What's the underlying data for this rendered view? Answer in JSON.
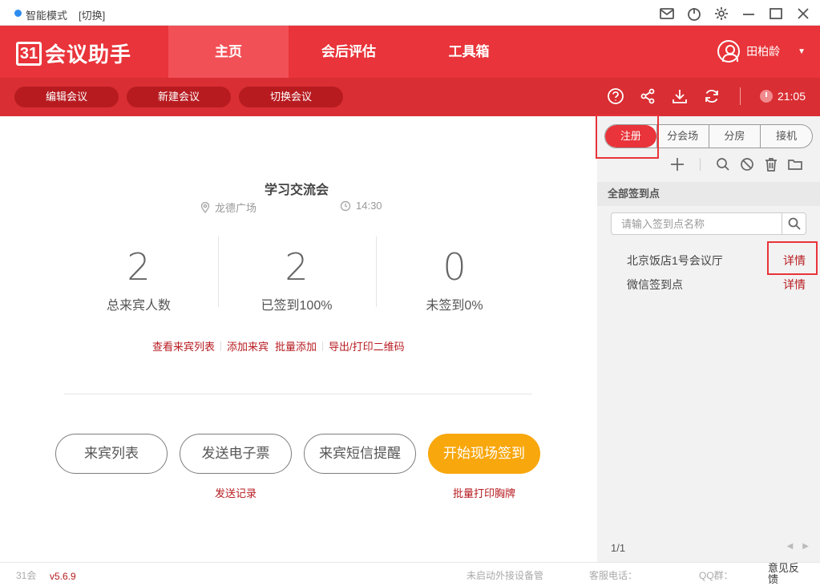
{
  "titlebar": {
    "mode_label": "智能模式",
    "switch_label": "[切换]"
  },
  "header": {
    "logo_box": "31",
    "logo_text": "会议助手",
    "tabs": [
      {
        "label": "主页"
      },
      {
        "label": "会后评估"
      },
      {
        "label": "工具箱"
      }
    ],
    "user_name": "田柏龄"
  },
  "toolbar": {
    "edit_meeting": "编辑会议",
    "new_meeting": "新建会议",
    "switch_meeting": "切换会议",
    "time": "21:05"
  },
  "meeting": {
    "title": "学习交流会",
    "location": "龙德广场",
    "time": "14:30"
  },
  "stats": [
    {
      "value": "2",
      "label": "总来宾人数"
    },
    {
      "value": "2",
      "label": "已签到100%"
    },
    {
      "value": "0",
      "label": "未签到0%"
    }
  ],
  "links": {
    "view_list": "查看来宾列表",
    "add_guest": "添加来宾",
    "batch_add": "批量添加",
    "export_qr": "导出/打印二维码"
  },
  "buttons": {
    "guest_list": "来宾列表",
    "send_ticket": "发送电子票",
    "sms_reminder": "来宾短信提醒",
    "start_checkin": "开始现场签到",
    "send_record": "发送记录",
    "print_badges": "批量打印胸牌"
  },
  "panel": {
    "tabs": [
      {
        "label": "注册"
      },
      {
        "label": "分会场"
      },
      {
        "label": "分房"
      },
      {
        "label": "接机"
      }
    ],
    "section_title": "全部签到点",
    "search_placeholder": "请输入签到点名称",
    "points": [
      {
        "name": "北京饭店1号会议厅",
        "detail": "详情"
      },
      {
        "name": "微信签到点",
        "detail": "详情"
      }
    ],
    "pager": "1/1"
  },
  "status": {
    "brand": "31会",
    "version": "v5.6.9",
    "device_status": "未启动外接设备管",
    "service_phone": "客服电话：",
    "qq_group": "QQ群：",
    "feedback": "意见反馈"
  },
  "colors": {
    "brand_red": "#e8343a",
    "dark_red": "#d92e33",
    "accent_orange": "#f8a70c",
    "link_red": "#b71b20"
  }
}
